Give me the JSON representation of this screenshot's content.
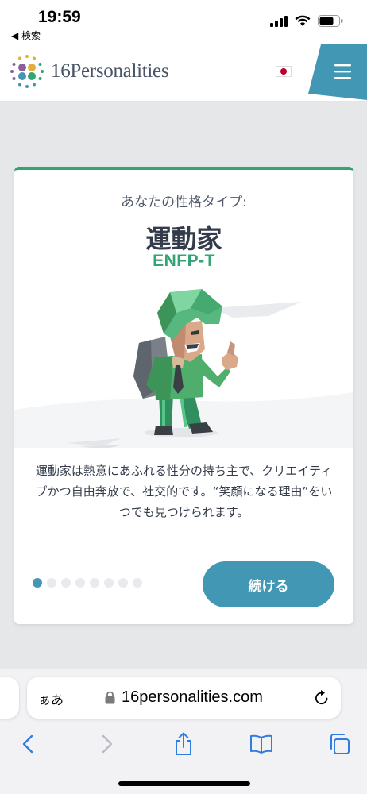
{
  "status_bar": {
    "time": "19:59",
    "back_label": "◀ 検索"
  },
  "header": {
    "logo_text": "16Personalities",
    "flag": "japan-flag",
    "menu_icon": "hamburger-menu-icon",
    "accent_color": "#4298b4"
  },
  "card": {
    "subtitle": "あなたの性格タイプ:",
    "type_name": "運動家",
    "type_code": "ENFP-T",
    "description": "運動家は熱意にあふれる性分の持ち主で、クリエイティブかつ自由奔放で、社交的です。“笑顔になる理由”をいつでも見つけられます。",
    "continue_label": "続ける",
    "pager": {
      "total": 8,
      "active": 1
    },
    "accent_color": "#33a474"
  },
  "safari": {
    "aa_label": "ぁあ",
    "url": "16personalities.com",
    "toolbar": [
      "back-icon",
      "forward-icon",
      "share-icon",
      "bookmarks-icon",
      "tabs-icon"
    ]
  }
}
